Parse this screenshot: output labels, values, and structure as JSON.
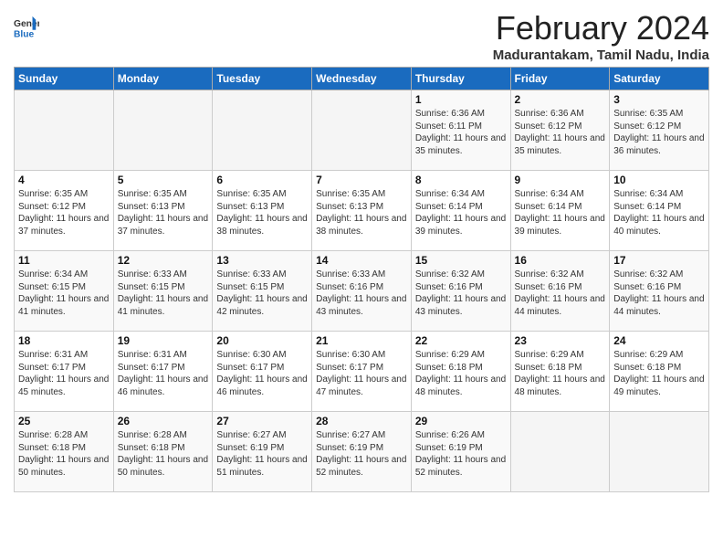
{
  "header": {
    "logo_general": "General",
    "logo_blue": "Blue",
    "title": "February 2024",
    "location": "Madurantakam, Tamil Nadu, India"
  },
  "columns": [
    "Sunday",
    "Monday",
    "Tuesday",
    "Wednesday",
    "Thursday",
    "Friday",
    "Saturday"
  ],
  "weeks": [
    [
      {
        "day": "",
        "sunrise": "",
        "sunset": "",
        "daylight": ""
      },
      {
        "day": "",
        "sunrise": "",
        "sunset": "",
        "daylight": ""
      },
      {
        "day": "",
        "sunrise": "",
        "sunset": "",
        "daylight": ""
      },
      {
        "day": "",
        "sunrise": "",
        "sunset": "",
        "daylight": ""
      },
      {
        "day": "1",
        "sunrise": "Sunrise: 6:36 AM",
        "sunset": "Sunset: 6:11 PM",
        "daylight": "Daylight: 11 hours and 35 minutes."
      },
      {
        "day": "2",
        "sunrise": "Sunrise: 6:36 AM",
        "sunset": "Sunset: 6:12 PM",
        "daylight": "Daylight: 11 hours and 35 minutes."
      },
      {
        "day": "3",
        "sunrise": "Sunrise: 6:35 AM",
        "sunset": "Sunset: 6:12 PM",
        "daylight": "Daylight: 11 hours and 36 minutes."
      }
    ],
    [
      {
        "day": "4",
        "sunrise": "Sunrise: 6:35 AM",
        "sunset": "Sunset: 6:12 PM",
        "daylight": "Daylight: 11 hours and 37 minutes."
      },
      {
        "day": "5",
        "sunrise": "Sunrise: 6:35 AM",
        "sunset": "Sunset: 6:13 PM",
        "daylight": "Daylight: 11 hours and 37 minutes."
      },
      {
        "day": "6",
        "sunrise": "Sunrise: 6:35 AM",
        "sunset": "Sunset: 6:13 PM",
        "daylight": "Daylight: 11 hours and 38 minutes."
      },
      {
        "day": "7",
        "sunrise": "Sunrise: 6:35 AM",
        "sunset": "Sunset: 6:13 PM",
        "daylight": "Daylight: 11 hours and 38 minutes."
      },
      {
        "day": "8",
        "sunrise": "Sunrise: 6:34 AM",
        "sunset": "Sunset: 6:14 PM",
        "daylight": "Daylight: 11 hours and 39 minutes."
      },
      {
        "day": "9",
        "sunrise": "Sunrise: 6:34 AM",
        "sunset": "Sunset: 6:14 PM",
        "daylight": "Daylight: 11 hours and 39 minutes."
      },
      {
        "day": "10",
        "sunrise": "Sunrise: 6:34 AM",
        "sunset": "Sunset: 6:14 PM",
        "daylight": "Daylight: 11 hours and 40 minutes."
      }
    ],
    [
      {
        "day": "11",
        "sunrise": "Sunrise: 6:34 AM",
        "sunset": "Sunset: 6:15 PM",
        "daylight": "Daylight: 11 hours and 41 minutes."
      },
      {
        "day": "12",
        "sunrise": "Sunrise: 6:33 AM",
        "sunset": "Sunset: 6:15 PM",
        "daylight": "Daylight: 11 hours and 41 minutes."
      },
      {
        "day": "13",
        "sunrise": "Sunrise: 6:33 AM",
        "sunset": "Sunset: 6:15 PM",
        "daylight": "Daylight: 11 hours and 42 minutes."
      },
      {
        "day": "14",
        "sunrise": "Sunrise: 6:33 AM",
        "sunset": "Sunset: 6:16 PM",
        "daylight": "Daylight: 11 hours and 43 minutes."
      },
      {
        "day": "15",
        "sunrise": "Sunrise: 6:32 AM",
        "sunset": "Sunset: 6:16 PM",
        "daylight": "Daylight: 11 hours and 43 minutes."
      },
      {
        "day": "16",
        "sunrise": "Sunrise: 6:32 AM",
        "sunset": "Sunset: 6:16 PM",
        "daylight": "Daylight: 11 hours and 44 minutes."
      },
      {
        "day": "17",
        "sunrise": "Sunrise: 6:32 AM",
        "sunset": "Sunset: 6:16 PM",
        "daylight": "Daylight: 11 hours and 44 minutes."
      }
    ],
    [
      {
        "day": "18",
        "sunrise": "Sunrise: 6:31 AM",
        "sunset": "Sunset: 6:17 PM",
        "daylight": "Daylight: 11 hours and 45 minutes."
      },
      {
        "day": "19",
        "sunrise": "Sunrise: 6:31 AM",
        "sunset": "Sunset: 6:17 PM",
        "daylight": "Daylight: 11 hours and 46 minutes."
      },
      {
        "day": "20",
        "sunrise": "Sunrise: 6:30 AM",
        "sunset": "Sunset: 6:17 PM",
        "daylight": "Daylight: 11 hours and 46 minutes."
      },
      {
        "day": "21",
        "sunrise": "Sunrise: 6:30 AM",
        "sunset": "Sunset: 6:17 PM",
        "daylight": "Daylight: 11 hours and 47 minutes."
      },
      {
        "day": "22",
        "sunrise": "Sunrise: 6:29 AM",
        "sunset": "Sunset: 6:18 PM",
        "daylight": "Daylight: 11 hours and 48 minutes."
      },
      {
        "day": "23",
        "sunrise": "Sunrise: 6:29 AM",
        "sunset": "Sunset: 6:18 PM",
        "daylight": "Daylight: 11 hours and 48 minutes."
      },
      {
        "day": "24",
        "sunrise": "Sunrise: 6:29 AM",
        "sunset": "Sunset: 6:18 PM",
        "daylight": "Daylight: 11 hours and 49 minutes."
      }
    ],
    [
      {
        "day": "25",
        "sunrise": "Sunrise: 6:28 AM",
        "sunset": "Sunset: 6:18 PM",
        "daylight": "Daylight: 11 hours and 50 minutes."
      },
      {
        "day": "26",
        "sunrise": "Sunrise: 6:28 AM",
        "sunset": "Sunset: 6:18 PM",
        "daylight": "Daylight: 11 hours and 50 minutes."
      },
      {
        "day": "27",
        "sunrise": "Sunrise: 6:27 AM",
        "sunset": "Sunset: 6:19 PM",
        "daylight": "Daylight: 11 hours and 51 minutes."
      },
      {
        "day": "28",
        "sunrise": "Sunrise: 6:27 AM",
        "sunset": "Sunset: 6:19 PM",
        "daylight": "Daylight: 11 hours and 52 minutes."
      },
      {
        "day": "29",
        "sunrise": "Sunrise: 6:26 AM",
        "sunset": "Sunset: 6:19 PM",
        "daylight": "Daylight: 11 hours and 52 minutes."
      },
      {
        "day": "",
        "sunrise": "",
        "sunset": "",
        "daylight": ""
      },
      {
        "day": "",
        "sunrise": "",
        "sunset": "",
        "daylight": ""
      }
    ]
  ]
}
